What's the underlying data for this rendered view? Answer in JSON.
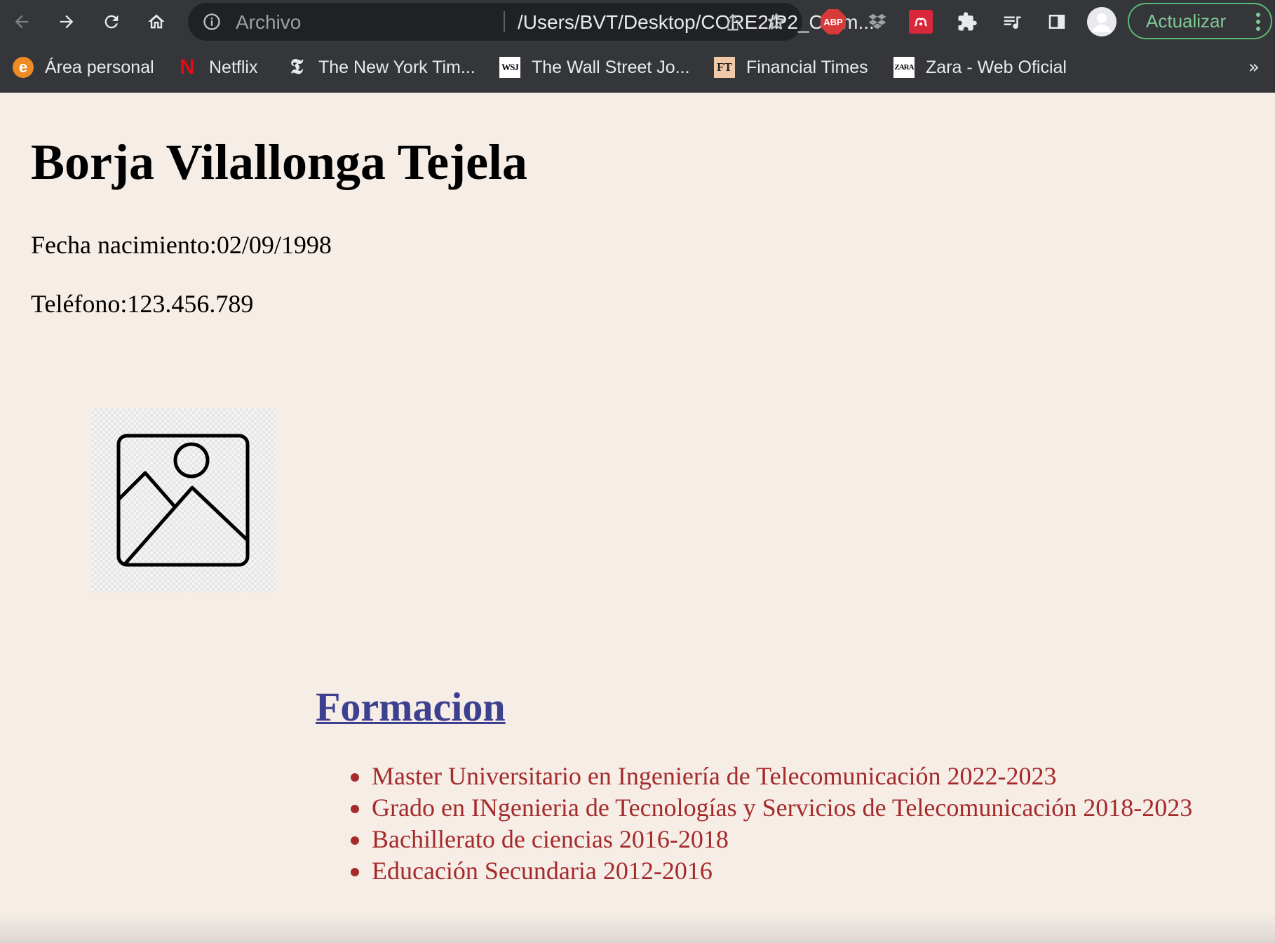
{
  "browser": {
    "address_scheme": "Archivo",
    "address_url": "/Users/BVT/Desktop/CORE2/P2_CV-m...",
    "update_label": "Actualizar",
    "extensions": {
      "abp_label": "ABP"
    },
    "icons": [
      "back-arrow-icon",
      "forward-arrow-icon",
      "reload-icon",
      "home-icon",
      "info-icon",
      "share-icon",
      "star-icon",
      "dropbox-icon",
      "mendeley-icon",
      "puzzle-icon",
      "media-control-icon",
      "side-panel-icon",
      "profile-avatar-icon",
      "kebab-menu-icon"
    ]
  },
  "bookmarks": {
    "items": [
      {
        "label": "Área personal",
        "favicon_text": "e"
      },
      {
        "label": "Netflix",
        "favicon_text": "N"
      },
      {
        "label": "The New York Tim...",
        "favicon_text": "𝕿"
      },
      {
        "label": "The Wall Street Jo...",
        "favicon_text": "WSJ"
      },
      {
        "label": "Financial Times",
        "favicon_text": "FT"
      },
      {
        "label": "Zara - Web Oficial",
        "favicon_text": "ZARA"
      }
    ],
    "overflow_label": "»"
  },
  "page": {
    "name": "Borja Vilallonga Tejela",
    "birth": "Fecha nacimiento:02/09/1998",
    "phone": "Teléfono:123.456.789",
    "section_title": "Formacion",
    "education": [
      "Master Universitario en Ingeniería de Telecomunicación 2022-2023",
      "Grado en INgenieria de Tecnologías y Servicios de Telecomunicación 2018-2023",
      "Bachillerato de ciencias 2016-2018",
      "Educación Secundaria 2012-2016"
    ]
  },
  "colors": {
    "page_background": "#f5ede6",
    "heading_link": "#3d3f8f",
    "list_text": "#a52a2a",
    "chrome": "#35363a",
    "update_green": "#81c995"
  }
}
